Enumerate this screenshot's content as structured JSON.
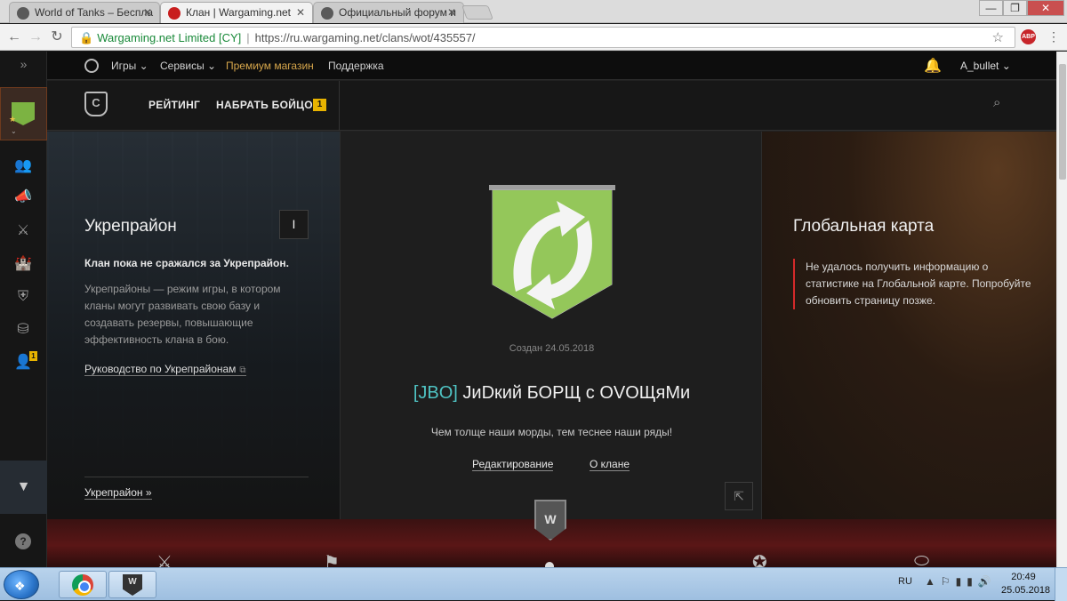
{
  "browser": {
    "tabs": [
      {
        "title": "World of Tanks – Беспла",
        "icon_color": "#5a5a5a"
      },
      {
        "title": "Клан | Wargaming.net",
        "icon_color": "#c81e1e"
      },
      {
        "title": "Официальный форум и",
        "icon_color": "#5a5a5a"
      }
    ],
    "address": {
      "org": "Wargaming.net Limited [CY]",
      "url": "https://ru.wargaming.net/clans/wot/435557/"
    },
    "window_buttons": [
      "—",
      "❐",
      "✕"
    ],
    "extension": "ABP"
  },
  "sidebar": {
    "expand_icon": "»",
    "items": [
      {
        "name": "clan-members-icon",
        "glyph": "👥"
      },
      {
        "name": "recruit-icon",
        "glyph": "📣"
      },
      {
        "name": "battles-icon",
        "glyph": "⚔"
      },
      {
        "name": "stronghold-icon",
        "glyph": "🏰"
      },
      {
        "name": "clan-shield-icon",
        "glyph": "⛨"
      },
      {
        "name": "treasury-icon",
        "glyph": "⛁"
      },
      {
        "name": "add-member-icon",
        "glyph": "👤"
      }
    ],
    "invite_badge": "1",
    "help": "?"
  },
  "topnav": {
    "games": "Игры ⌄",
    "services": "Сервисы ⌄",
    "premium": "Премиум магазин",
    "support": "Поддержка",
    "user": "A_bullet ⌄"
  },
  "clanbar": {
    "rating": "РЕЙТИНГ",
    "recruit": "НАБРАТЬ БОЙЦОВ",
    "recruit_badge": "1"
  },
  "stronghold": {
    "title": "Укрепрайон",
    "level": "I",
    "status": "Клан пока не сражался за Укрепрайон.",
    "description": "Укрепрайоны — режим игры, в котором кланы могут развивать свою базу и создавать резервы, повышающие эффективность клана в бою.",
    "guide_link": "Руководство по Укрепрайонам",
    "more_link": "Укрепрайон »"
  },
  "clan": {
    "created": "Создан 24.05.2018",
    "tag": "[JBO]",
    "name": "JиDкий БОРЩ с OVOЩяMи",
    "motto": "Чем толще наши морды, тем теснее наши ряды!",
    "edit_link": "Редактирование",
    "about_link": "О клане",
    "emblem_color": "#8bc34a"
  },
  "global_map": {
    "title": "Глобальная карта",
    "message": "Не удалось получить информацию о статистике на Глобальной карте. Попробуйте обновить страницу позже."
  },
  "taskbar": {
    "lang": "RU",
    "time": "20:49",
    "date": "25.05.2018"
  }
}
